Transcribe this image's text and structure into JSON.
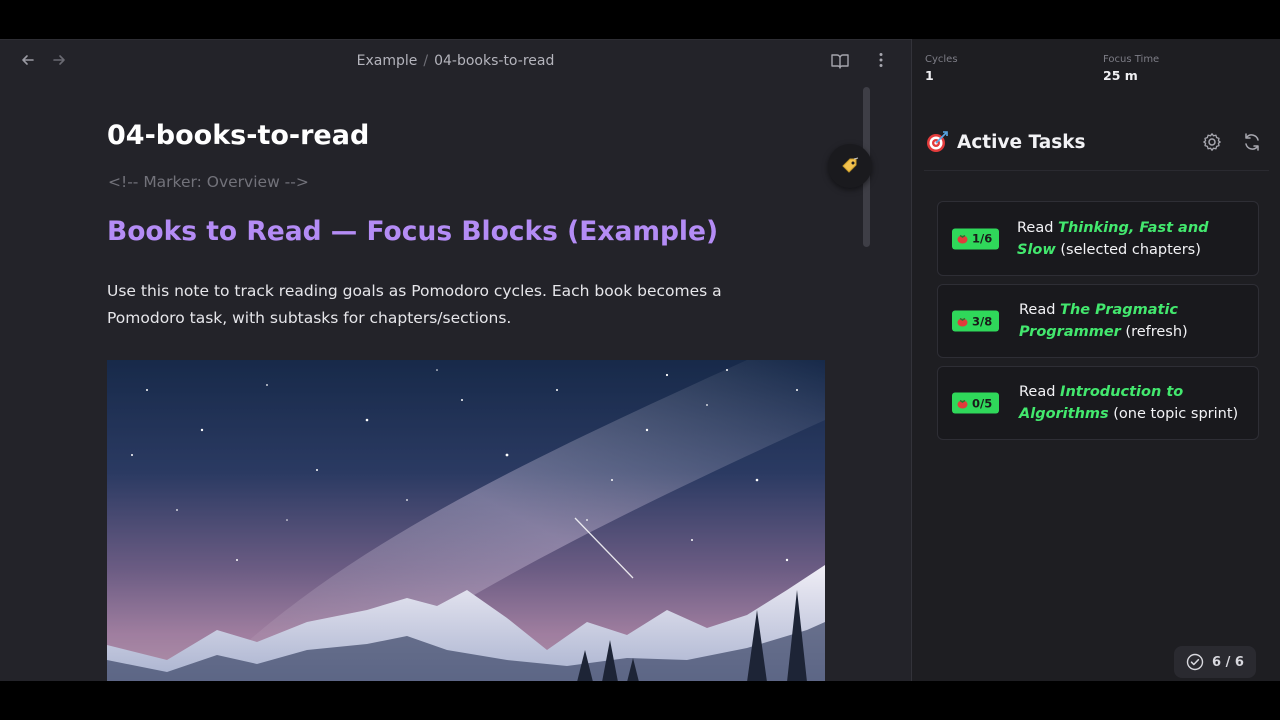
{
  "editor": {
    "breadcrumb": {
      "folder": "Example",
      "separator": "/",
      "file": "04-books-to-read"
    },
    "icons": {
      "back": "arrow-left-icon",
      "forward": "arrow-right-icon",
      "reader": "book-open-icon",
      "more": "more-vertical-icon",
      "tag": "tag-icon"
    },
    "note": {
      "title": "04-books-to-read",
      "marker": "<!-- Marker: Overview -->",
      "heading": "Books to Read — Focus Blocks (Example)",
      "paragraph": "Use this note to track reading goals as Pomodoro cycles. Each book becomes a Pomodoro task, with subtasks for chapters/sections."
    }
  },
  "sidebar": {
    "stats": {
      "cycles_label": "Cycles",
      "cycles_value": "1",
      "focus_label": "Focus Time",
      "focus_value": "25 m"
    },
    "tasks_title": "Active Tasks",
    "tasks": [
      {
        "badge": "1/6",
        "prefix": "Read ",
        "book": "Thinking, Fast and Slow",
        "suffix": " (selected chapters)"
      },
      {
        "badge": "3/8",
        "prefix": "Read ",
        "book": "The Pragmatic Programmer",
        "suffix": " (refresh)"
      },
      {
        "badge": "0/5",
        "prefix": "Read ",
        "book": "Introduction to Algorithms",
        "suffix": " (one topic sprint)"
      }
    ],
    "completed_count": "6 / 6"
  },
  "colors": {
    "heading_purple": "#b48cf5",
    "badge_green": "#2fd85a",
    "book_green": "#43e86e",
    "editor_bg": "#232329",
    "sidebar_bg": "#1e1e22"
  }
}
